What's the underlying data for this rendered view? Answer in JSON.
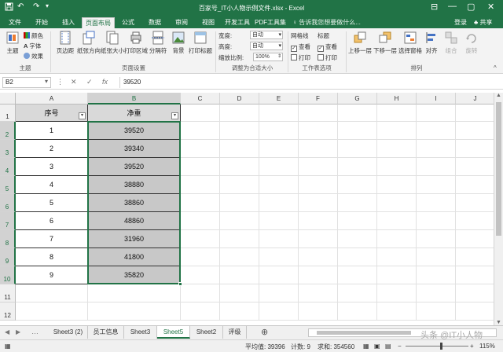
{
  "titlebar": {
    "title": "百家号_IT小人物示例文件.xlsx - Excel",
    "save_icon": "save-icon",
    "undo_icon": "undo-icon",
    "redo_icon": "redo-icon",
    "minimize": "—",
    "restore": "▢",
    "close": "✕",
    "ribbon_display": "⊟"
  },
  "tabs": [
    {
      "label": "文件",
      "active": false
    },
    {
      "label": "开始",
      "active": false
    },
    {
      "label": "插入",
      "active": false
    },
    {
      "label": "页面布局",
      "active": true
    },
    {
      "label": "公式",
      "active": false
    },
    {
      "label": "数据",
      "active": false
    },
    {
      "label": "审阅",
      "active": false
    },
    {
      "label": "视图",
      "active": false
    },
    {
      "label": "开发工具",
      "active": false
    },
    {
      "label": "PDF工具集",
      "active": false
    }
  ],
  "tell_me": "♀ 告诉我您想要做什么...",
  "login": "登录",
  "share": "♣ 共享",
  "ribbon": {
    "themes": {
      "theme": "主题",
      "colors": "颜色",
      "fonts": "字体",
      "effects": "效果",
      "group": "主题"
    },
    "page_setup": {
      "margins": "页边距",
      "orientation": "纸张方向",
      "size": "纸张大小",
      "print_area": "打印区域",
      "breaks": "分隔符",
      "background": "背景",
      "print_titles": "打印标题",
      "group": "页面设置"
    },
    "scale": {
      "width_label": "宽度:",
      "width_value": "自动",
      "height_label": "高度:",
      "height_value": "自动",
      "scale_label": "缩放比例:",
      "scale_value": "100%",
      "group": "调整为合适大小"
    },
    "sheet_options": {
      "gridlines": "网格线",
      "headings": "标题",
      "view": "查看",
      "print": "打印",
      "group": "工作表选项"
    },
    "arrange": {
      "forward": "上移一层",
      "backward": "下移一层",
      "selection_pane": "选择窗格",
      "align": "对齐",
      "group_btn": "组合",
      "rotate": "旋转",
      "group": "排列"
    }
  },
  "formula_bar": {
    "name_box": "B2",
    "cancel": "✕",
    "enter": "✓",
    "fx": "fx",
    "value": "39520"
  },
  "columns": [
    "A",
    "B",
    "C",
    "D",
    "E",
    "F",
    "G",
    "H",
    "I",
    "J"
  ],
  "rows": [
    "1",
    "2",
    "3",
    "4",
    "5",
    "6",
    "7",
    "8",
    "9",
    "10",
    "11",
    "12"
  ],
  "table": {
    "headers": [
      "序号",
      "净重"
    ],
    "rows": [
      [
        "1",
        "39520"
      ],
      [
        "2",
        "39340"
      ],
      [
        "3",
        "39520"
      ],
      [
        "4",
        "38880"
      ],
      [
        "5",
        "38860"
      ],
      [
        "6",
        "48860"
      ],
      [
        "7",
        "31960"
      ],
      [
        "8",
        "41800"
      ],
      [
        "9",
        "35820"
      ]
    ]
  },
  "sheets": [
    {
      "label": "Sheet3 (2)",
      "active": false
    },
    {
      "label": "员工信息",
      "active": false
    },
    {
      "label": "Sheet3",
      "active": false
    },
    {
      "label": "Sheet5",
      "active": true
    },
    {
      "label": "Sheet2",
      "active": false
    },
    {
      "label": "评级",
      "active": false
    }
  ],
  "add_sheet": "⊕",
  "status": {
    "average": "平均值: 39396",
    "count": "计数: 9",
    "sum": "求和: 354560",
    "zoom": "115%"
  },
  "watermark": "头条 @IT小人物",
  "colors": {
    "excel_green": "#217346",
    "selection_fill": "#c8c8c8",
    "header_fill": "#d9d9d9"
  }
}
